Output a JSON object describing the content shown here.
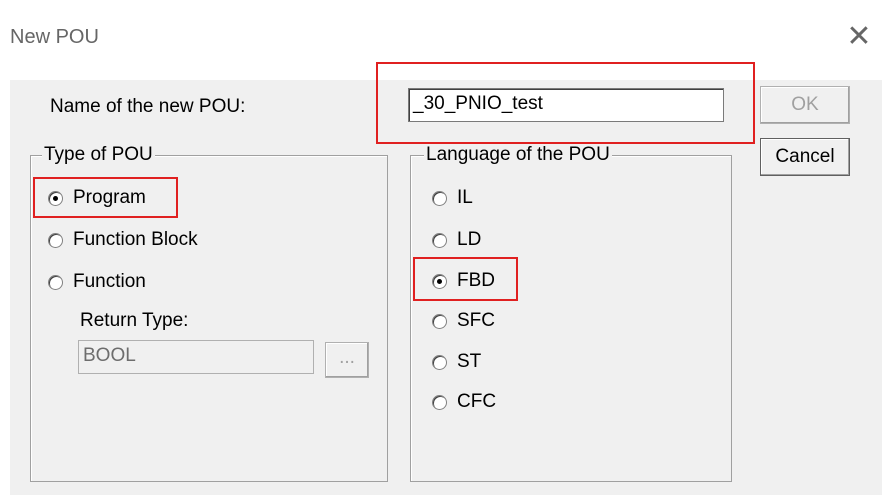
{
  "window": {
    "title": "New POU"
  },
  "name_field": {
    "label": "Name of the new POU:",
    "value": "_30_PNIO_test"
  },
  "buttons": {
    "ok": "OK",
    "cancel": "Cancel"
  },
  "type_group": {
    "legend": "Type of POU",
    "options": [
      "Program",
      "Function Block",
      "Function"
    ],
    "selected": "Program",
    "return_type_label": "Return Type:",
    "return_type_value": "BOOL",
    "browse_label": "..."
  },
  "language_group": {
    "legend": "Language of the POU",
    "options": [
      "IL",
      "LD",
      "FBD",
      "SFC",
      "ST",
      "CFC"
    ],
    "selected": "FBD"
  },
  "highlight_color": "#e02020"
}
